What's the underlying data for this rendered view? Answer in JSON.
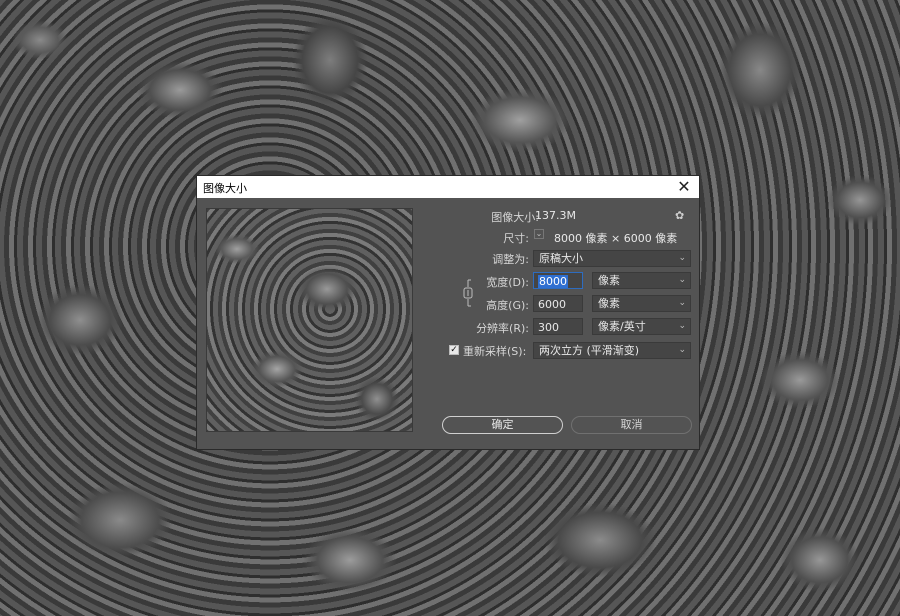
{
  "dialog": {
    "title": "图像大小",
    "close_glyph": "✕",
    "image_size_label": "图像大小:",
    "image_size_value": "137.3M",
    "gear_glyph": "✿",
    "dimensions_label": "尺寸:",
    "dimensions_value": "8000 像素  ×  6000 像素",
    "fit_to_label": "调整为:",
    "fit_to_value": "原稿大小",
    "width_label": "宽度(D):",
    "width_value": "8000",
    "width_unit": "像素",
    "height_label": "高度(G):",
    "height_value": "6000",
    "height_unit": "像素",
    "resolution_label": "分辨率(R):",
    "resolution_value": "300",
    "resolution_unit": "像素/英寸",
    "resample_label": "重新采样(S):",
    "resample_checked": "✓",
    "resample_value": "两次立方 (平滑渐变)",
    "ok_label": "确定",
    "cancel_label": "取消",
    "dropdown_arrow": "⌄"
  }
}
